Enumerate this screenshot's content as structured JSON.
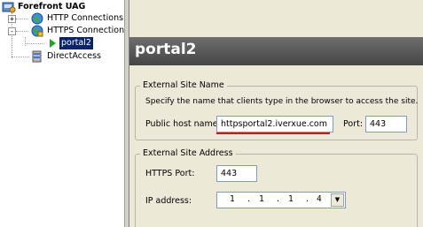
{
  "tree": {
    "root": {
      "label": "Forefront UAG",
      "icon": "uag-icon"
    },
    "http": {
      "label": "HTTP Connections",
      "expander": "+",
      "icon": "globe-icon"
    },
    "https": {
      "label": "HTTPS Connections",
      "expander": "-",
      "icon": "secure-globe-icon"
    },
    "portal": {
      "label": "portal2",
      "icon": "play-arrow-icon"
    },
    "directaccess": {
      "label": "DirectAccess",
      "icon": "server-icon"
    }
  },
  "main": {
    "title": "portal2",
    "external_site_name": {
      "legend": "External Site Name",
      "description": "Specify the name that clients type in the browser to access the site.",
      "host_label": "Public host name:",
      "host_value": "httpsportal2.iverxue.com",
      "port_label": "Port:",
      "port_value": "443"
    },
    "external_site_address": {
      "legend": "External Site Address",
      "https_port_label": "HTTPS Port:",
      "https_port_value": "443",
      "ip_label": "IP address:",
      "ip_segments": [
        "1",
        "1",
        "1",
        "4"
      ]
    }
  },
  "colors": {
    "header_bg": "#555555",
    "selection": "#0a246a",
    "annotation": "#cc1a1a",
    "panel_bg": "#ece9d8"
  }
}
